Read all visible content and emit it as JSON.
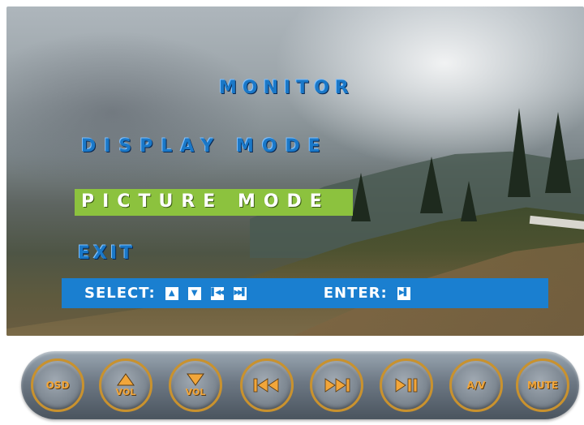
{
  "osd": {
    "title": "MONITOR",
    "items": [
      {
        "label": "DISPLAY MODE",
        "selected": false
      },
      {
        "label": "PICTURE MODE",
        "selected": true
      },
      {
        "label": "EXIT",
        "selected": false
      }
    ],
    "help_bar": {
      "select_label": "SELECT:",
      "select_icons": [
        "up-arrow-icon",
        "down-arrow-icon",
        "previous-icon",
        "next-icon"
      ],
      "enter_label": "ENTER:",
      "enter_icon": "play-pause-icon"
    }
  },
  "buttons": {
    "osd": "OSD",
    "vol_up_sub": "VOL",
    "vol_down_sub": "VOL",
    "av": "A/V",
    "mute": "MUTE"
  },
  "colors": {
    "menu_text": "#1a78c8",
    "selected_bg": "#8cc23e",
    "help_bar_bg": "#1a7fd0",
    "button_accent": "#f2a63a",
    "button_ring": "#c9922e"
  }
}
